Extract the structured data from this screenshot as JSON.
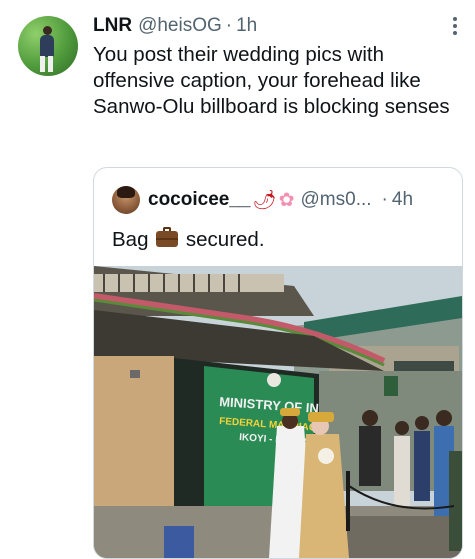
{
  "tweet": {
    "avatar_icon": "user-avatar-icon",
    "author_name": "LNR",
    "author_handle": "@heisOG",
    "separator": "·",
    "time": "1h",
    "text": "You post their wedding pics with offensive caption, your forehead like Sanwo-Olu billboard is blocking senses",
    "more_icon": "more-options-icon"
  },
  "quote": {
    "author_name": "cocoicee__",
    "name_emoji": [
      "hot-pepper-icon",
      "cherry-blossom-icon"
    ],
    "author_handle": "@ms0...",
    "separator": "·",
    "time": "4h",
    "text_before": "Bag",
    "text_emoji": "briefcase-icon",
    "text_after": "secured.",
    "photo": {
      "sign_line1": "MINISTRY OF INTERIOR",
      "sign_line2": "FEDERAL MARRIAGE",
      "sign_line3": "IKOYI - LAGOS"
    }
  },
  "colors": {
    "text_primary": "#0f1419",
    "text_secondary": "#536471",
    "border": "#cfd9de",
    "sign_green": "#1f7a4a"
  }
}
